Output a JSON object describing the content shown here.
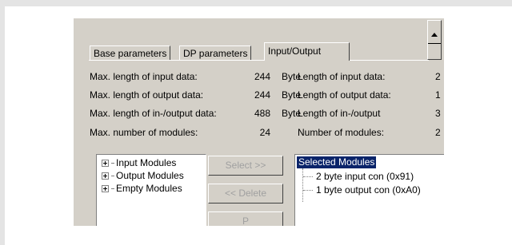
{
  "tabs": [
    {
      "label": "Base parameters"
    },
    {
      "label": "DP parameters"
    },
    {
      "label": "Input/Output"
    }
  ],
  "params": [
    {
      "label": "Max. length of input data:",
      "value": "244",
      "unit": "Byte",
      "right_label": "Length of input data:",
      "right_value": "2"
    },
    {
      "label": "Max. length of output data:",
      "value": "244",
      "unit": "Byte",
      "right_label": "Length of output data:",
      "right_value": "1"
    },
    {
      "label": "Max. length of in-/output data:",
      "value": "488",
      "unit": "Byte",
      "right_label": "Length of in-/output",
      "right_value": "3"
    },
    {
      "label": "Max. number of modules:",
      "value": "24",
      "unit": "",
      "right_label": "Number of modules:",
      "right_value": "2"
    }
  ],
  "module_tree": [
    {
      "label": "Input Modules"
    },
    {
      "label": "Output Modules"
    },
    {
      "label": "Empty Modules"
    }
  ],
  "buttons": {
    "select": "Select >>",
    "delete": "<< Delete",
    "third": "P"
  },
  "selected_modules": {
    "header": "Selected Modules",
    "items": [
      {
        "label": "2  byte input con  (0x91)"
      },
      {
        "label": "1  byte output con (0xA0)"
      }
    ]
  },
  "colors": {
    "dialog_bg": "#d4d0c8",
    "selection": "#0a246a"
  }
}
